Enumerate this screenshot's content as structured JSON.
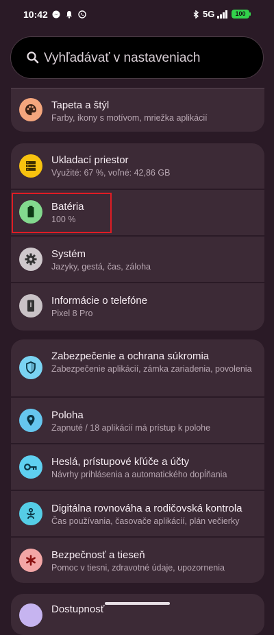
{
  "status": {
    "time": "10:42",
    "network": "5G",
    "battery": "100"
  },
  "search": {
    "placeholder": "Vyhľadávať v nastaveniach"
  },
  "items": {
    "wallpaper": {
      "title": "Tapeta a štýl",
      "subtitle": "Farby, ikony s motívom, mriežka aplikácií"
    },
    "storage": {
      "title": "Ukladací priestor",
      "subtitle": "Využité: 67 %, voľné: 42,86 GB"
    },
    "battery": {
      "title": "Batéria",
      "subtitle": "100 %"
    },
    "system": {
      "title": "Systém",
      "subtitle": "Jazyky, gestá, čas, záloha"
    },
    "about": {
      "title": "Informácie o telefóne",
      "subtitle": "Pixel 8 Pro"
    },
    "security": {
      "title": "Zabezpečenie a ochrana súkromia",
      "subtitle": "Zabezpečenie aplikácií, zámka zariadenia, povolenia"
    },
    "location": {
      "title": "Poloha",
      "subtitle": "Zapnuté / 18 aplikácií má prístup k polohe"
    },
    "passwords": {
      "title": "Heslá, prístupové kľúče a účty",
      "subtitle": "Návrhy prihlásenia a automatického dopĺňania"
    },
    "wellbeing": {
      "title": "Digitálna rovnováha a rodičovská kontrola",
      "subtitle": "Čas používania, časovače aplikácií, plán večierky"
    },
    "safety": {
      "title": "Bezpečnosť a tieseň",
      "subtitle": "Pomoc v tiesni, zdravotné údaje, upozornenia"
    },
    "accessibility": {
      "title": "Dostupnosť"
    }
  },
  "colors": {
    "wallpaper_icon": "#f4a67d",
    "storage_icon": "#f7c20f",
    "battery_icon": "#83d98e",
    "system_icon": "#cfc8cc",
    "about_icon": "#c9c2c6",
    "security_icon": "#7ad3f2",
    "location_icon": "#66c6ee",
    "passwords_icon": "#5fd0f0",
    "wellbeing_icon": "#55cde6",
    "safety_icon": "#f3a6a6",
    "highlight": "#e01c24"
  }
}
